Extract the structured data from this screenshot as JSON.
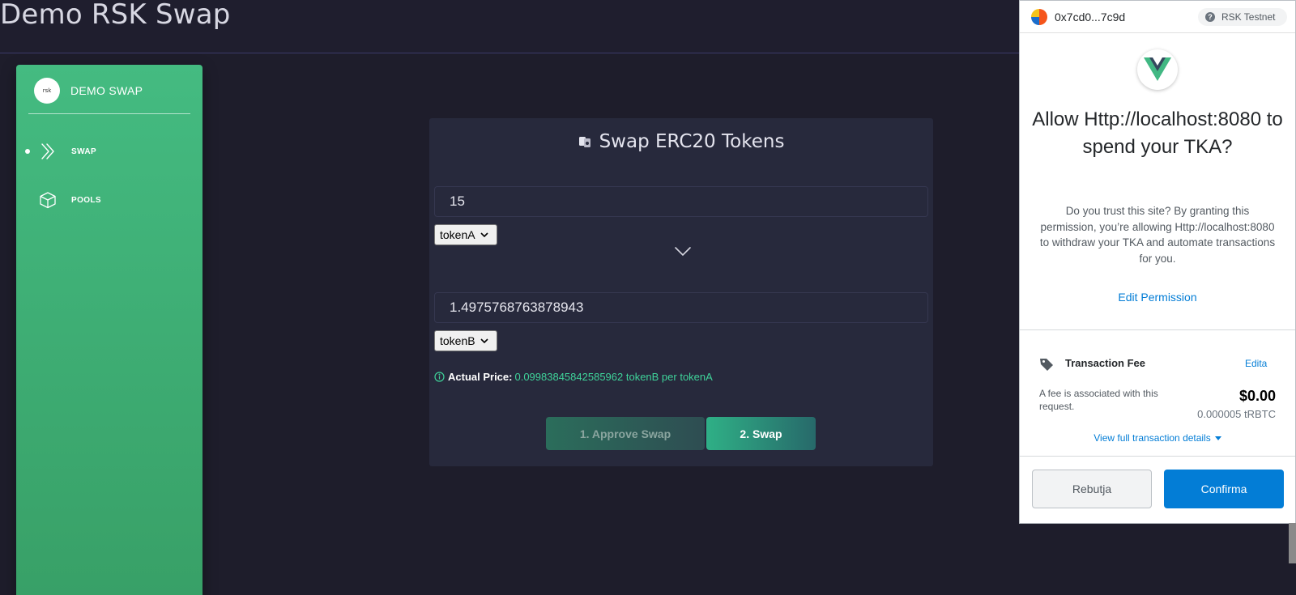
{
  "header": {
    "title": "Demo RSK Swap"
  },
  "sidebar": {
    "brand_logo_text": "rsk",
    "brand_name": "DEMO SWAP",
    "items": [
      {
        "label": "SWAP",
        "icon": "double-chevron-right-icon",
        "active": true
      },
      {
        "label": "POOLS",
        "icon": "cube-icon",
        "active": false
      }
    ]
  },
  "swap": {
    "title": "Swap ERC20 Tokens",
    "amount_a": "15",
    "token_a": "tokenA",
    "amount_b": "1.4975768763878943",
    "token_b": "tokenB",
    "price_label": "Actual Price:",
    "price_value": "0.09983845842585962 tokenB per tokenA",
    "approve_button": "1. Approve Swap",
    "swap_button": "2. Swap",
    "colors": {
      "accent": "#3fd39a",
      "sidebar": "#44bb81"
    }
  },
  "metamask": {
    "account": "0x7cd0...7c9d",
    "network": "RSK Testnet",
    "heading": "Allow Http://localhost:8080 to spend your TKA?",
    "description": "Do you trust this site? By granting this permission, you’re allowing Http://localhost:8080 to withdraw your TKA and automate transactions for you.",
    "edit_permission": "Edit Permission",
    "fee_title": "Transaction Fee",
    "fee_edit": "Edita",
    "fee_note": "A fee is associated with this request.",
    "fee_usd": "$0.00",
    "fee_native": "0.000005 tRBTC",
    "view_details": "View full transaction details",
    "reject_button": "Rebutja",
    "confirm_button": "Confirma",
    "colors": {
      "primary": "#037dd6"
    }
  }
}
